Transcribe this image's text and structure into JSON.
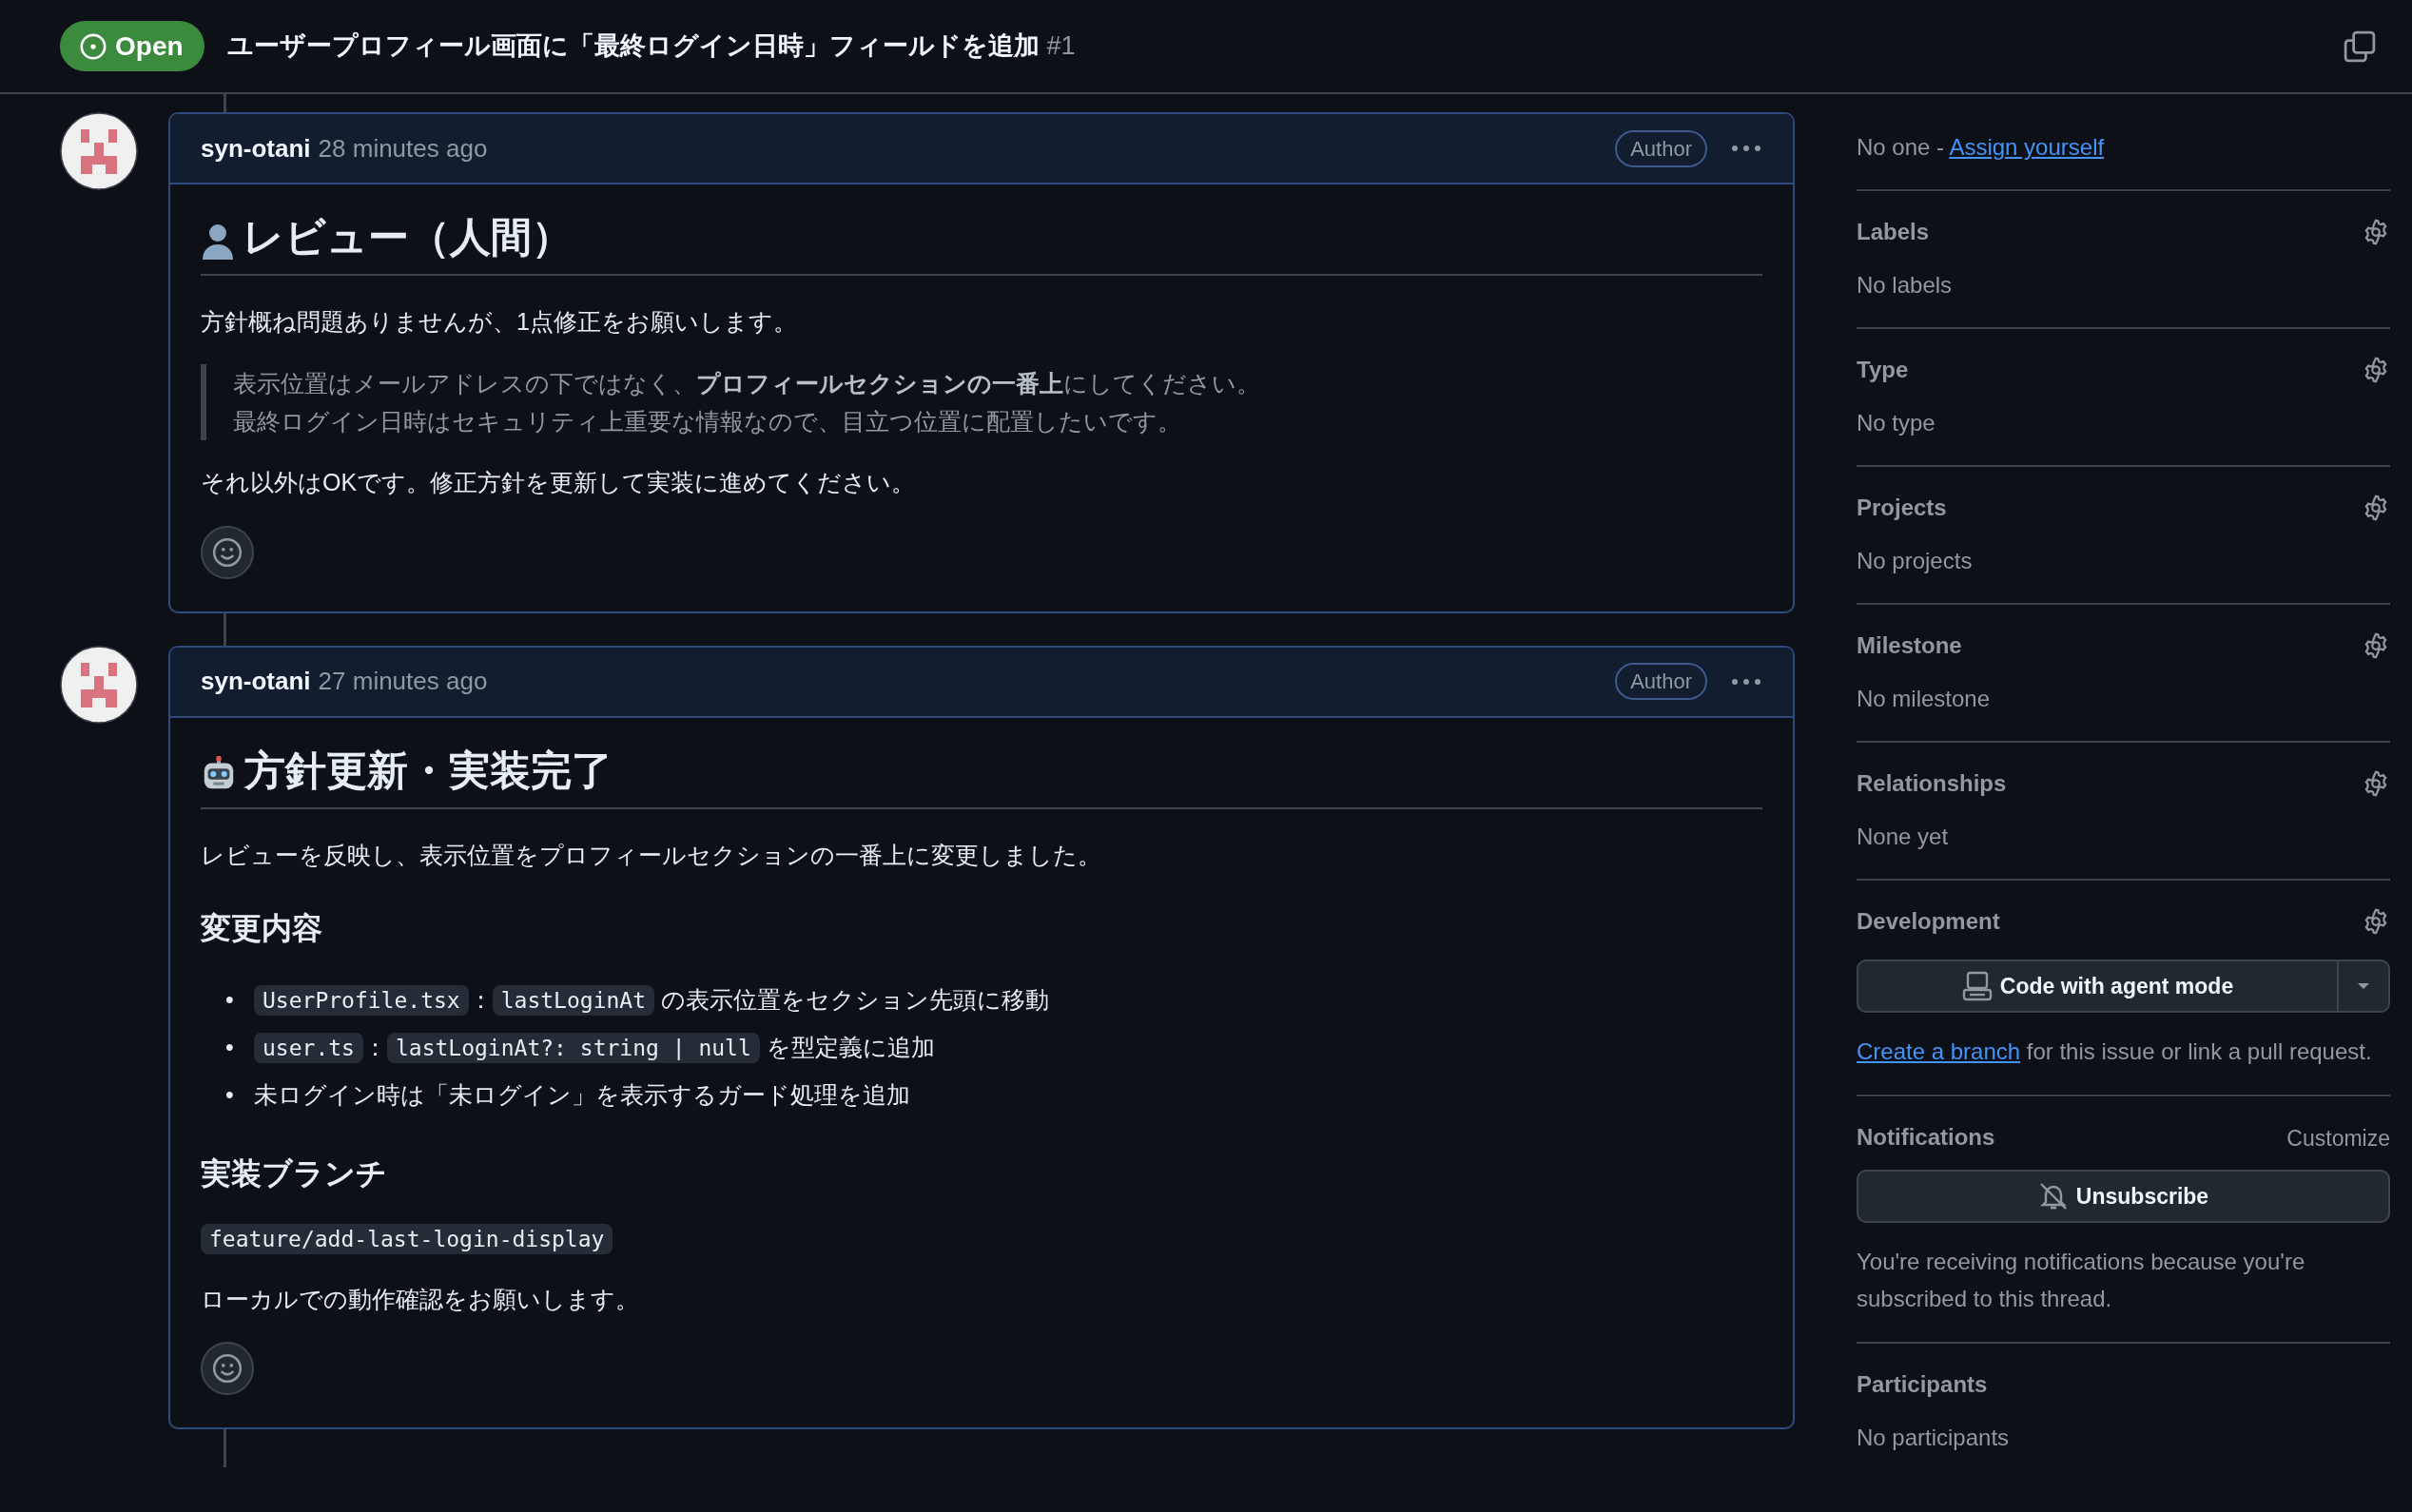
{
  "header": {
    "state": {
      "label": "Open",
      "open": true
    },
    "title": "ユーザープロフィール画面に「最終ログイン日時」フィールドを追加",
    "number": "#1"
  },
  "comments": [
    {
      "author": "syn-otani",
      "time": "28 minutes ago",
      "badge": "Author",
      "blocks": [
        {
          "kind": "h1",
          "text": "レビュー（人間）"
        },
        {
          "kind": "p",
          "text": "方針概ね問題ありませんが、1点修正をお願いします。"
        },
        {
          "kind": "quote",
          "lines": [
            "表示位置はメールアドレスの下ではなく、**プロフィールセクションの一番上**にしてください。",
            "最終ログイン日時はセキュリティ上重要な情報なので、目立つ位置に配置したいです。"
          ]
        },
        {
          "kind": "p",
          "text": "それ以外はOKです。修正方針を更新して実装に進めてください。"
        }
      ]
    },
    {
      "author": "syn-otani",
      "time": "27 minutes ago",
      "badge": "Author",
      "blocks": [
        {
          "kind": "h1",
          "text": "方針更新・実装完了"
        },
        {
          "kind": "p",
          "text": "レビューを反映し、表示位置をプロフィールセクションの一番上に変更しました。"
        },
        {
          "kind": "h2",
          "text": "変更内容"
        },
        {
          "kind": "list",
          "items": [
            {
              "bullet": "•",
              "segments": [
                {
                  "kind": "code",
                  "text": "UserProfile.tsx"
                },
                {
                  "kind": "text",
                  "text": "："
                },
                {
                  "kind": "code",
                  "text": "lastLoginAt"
                },
                {
                  "kind": "text",
                  "text": " の表示位置をセクション先頭に移動"
                }
              ]
            },
            {
              "bullet": "•",
              "segments": [
                {
                  "kind": "code",
                  "text": "user.ts"
                },
                {
                  "kind": "text",
                  "text": "："
                },
                {
                  "kind": "code",
                  "text": "lastLoginAt?: string | null"
                },
                {
                  "kind": "text",
                  "text": " を型定義に追加"
                }
              ]
            },
            {
              "bullet": "•",
              "segments": [
                {
                  "kind": "text",
                  "text": "未ログイン時は「未ログイン」を表示するガード処理を追加"
                }
              ]
            }
          ]
        },
        {
          "kind": "h2",
          "text": "実装ブランチ"
        },
        {
          "kind": "code",
          "text": "feature/add-last-login-display"
        },
        {
          "kind": "p",
          "text": "ローカルでの動作確認をお願いします。"
        }
      ]
    }
  ],
  "sidebar": [
    {
      "kind": "assignees",
      "text": "No one - ",
      "link": "Assign yourself"
    },
    {
      "kind": "field",
      "title": "Labels",
      "value": "No labels"
    },
    {
      "kind": "field",
      "title": "Type",
      "value": "No type"
    },
    {
      "kind": "field",
      "title": "Projects",
      "value": "No projects"
    },
    {
      "kind": "field",
      "title": "Milestone",
      "value": "No milestone"
    },
    {
      "kind": "field",
      "title": "Relationships",
      "value": "None yet"
    },
    {
      "kind": "development",
      "title": "Development",
      "button": "Code with agent mode",
      "link": "Create a branch",
      "text": " for this issue or link a pull request."
    },
    {
      "kind": "notifications",
      "title": "Notifications",
      "action": "Customize",
      "button": "Unsubscribe",
      "note": "You're receiving notifications because you're subscribed to this thread."
    },
    {
      "kind": "plain",
      "title": "Participants",
      "value": "No participants"
    }
  ]
}
